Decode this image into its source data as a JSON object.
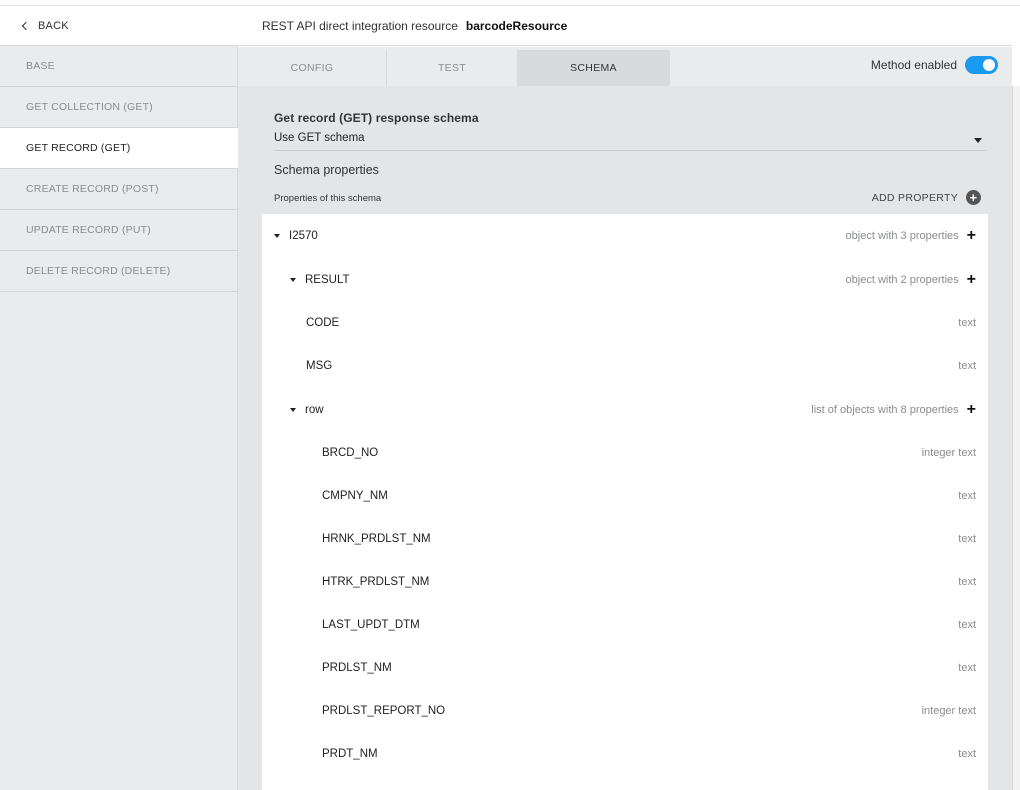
{
  "sidebar": {
    "back_label": "BACK",
    "items": [
      {
        "label": "BASE"
      },
      {
        "label": "GET COLLECTION (GET)"
      },
      {
        "label": "GET RECORD (GET)"
      },
      {
        "label": "CREATE RECORD (POST)"
      },
      {
        "label": "UPDATE RECORD (PUT)"
      },
      {
        "label": "DELETE RECORD (DELETE)"
      }
    ],
    "active_index": 2
  },
  "header": {
    "prefix": "REST API direct integration resource",
    "resource_name": "barcodeResource"
  },
  "tabs": [
    {
      "label": "CONFIG"
    },
    {
      "label": "TEST"
    },
    {
      "label": "SCHEMA"
    }
  ],
  "active_tab": 2,
  "method_toggle": {
    "label": "Method enabled",
    "enabled": true,
    "color": "#1a9bf0"
  },
  "schema": {
    "section_title": "Get record (GET) response schema",
    "select_value": "Use GET schema",
    "properties_title": "Schema properties",
    "properties_subtitle": "Properties of this schema",
    "add_property_label": "ADD PROPERTY",
    "tree": [
      {
        "name": "I2570",
        "type": "object with 3 properties",
        "expandable": true
      },
      {
        "name": "RESULT",
        "type": "object with 2 properties",
        "expandable": true
      },
      {
        "name": "CODE",
        "type": "text",
        "expandable": false
      },
      {
        "name": "MSG",
        "type": "text",
        "expandable": false
      },
      {
        "name": "row",
        "type": "list of objects with 8 properties",
        "expandable": true
      },
      {
        "name": "BRCD_NO",
        "type": "integer text",
        "expandable": false
      },
      {
        "name": "CMPNY_NM",
        "type": "text",
        "expandable": false
      },
      {
        "name": "HRNK_PRDLST_NM",
        "type": "text",
        "expandable": false
      },
      {
        "name": "HTRK_PRDLST_NM",
        "type": "text",
        "expandable": false
      },
      {
        "name": "LAST_UPDT_DTM",
        "type": "text",
        "expandable": false
      },
      {
        "name": "PRDLST_NM",
        "type": "text",
        "expandable": false
      },
      {
        "name": "PRDLST_REPORT_NO",
        "type": "integer text",
        "expandable": false
      },
      {
        "name": "PRDT_NM",
        "type": "text",
        "expandable": false
      }
    ]
  }
}
